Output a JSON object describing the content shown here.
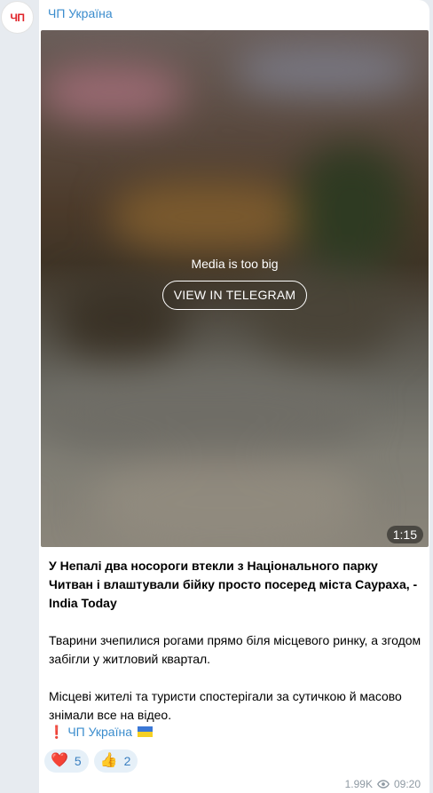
{
  "channel": {
    "name": "ЧП Україна",
    "avatar_text": "ЧП"
  },
  "media": {
    "message": "Media is too big",
    "button_label": "VIEW IN TELEGRAM",
    "duration": "1:15"
  },
  "post": {
    "headline": "У Непалі два носороги втекли з Національного парку Читван і влаштували бійку просто посеред міста Саураха, - India Today",
    "paragraph1": "Тварини зчепилися рогами прямо біля місцевого ринку, а згодом забігли у житловий квартал.",
    "paragraph2": "Місцеві жителі та туристи спостерігали за сутичкою й масово знімали все на відео.",
    "signature_mark": "❗",
    "signature": "ЧП Україна"
  },
  "reactions": [
    {
      "emoji": "❤️",
      "icon": "heart-icon",
      "count": "5"
    },
    {
      "emoji": "👍",
      "icon": "thumbs-up-icon",
      "count": "2"
    }
  ],
  "meta": {
    "views": "1.99K",
    "time": "09:20"
  },
  "colors": {
    "accent": "#3a8ccd",
    "background": "#e7ebf0",
    "reaction_bg": "#e6f0f8"
  }
}
